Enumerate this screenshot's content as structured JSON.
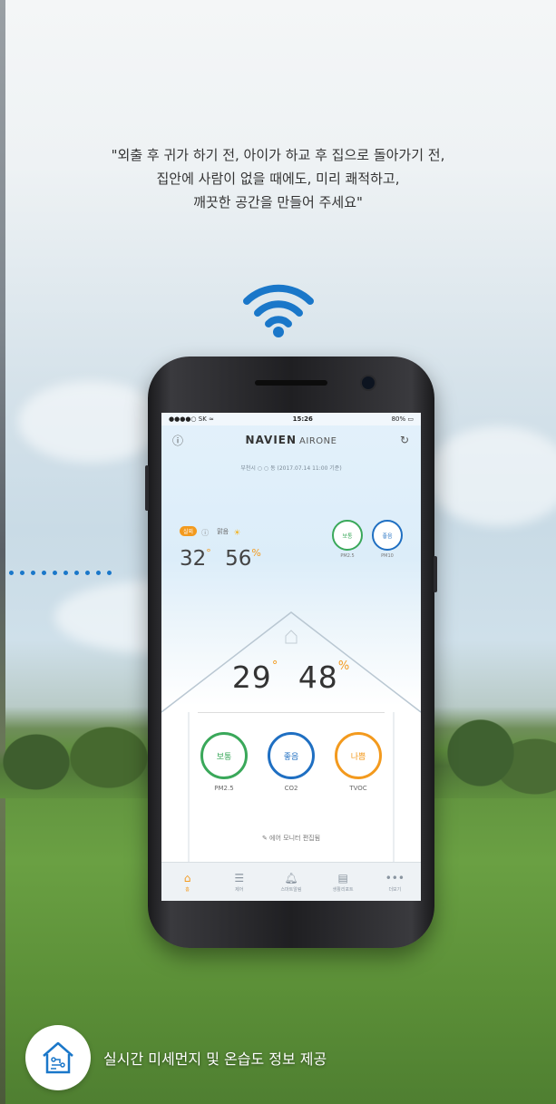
{
  "quote": {
    "line1": "\"외출 후 귀가 하기 전, 아이가 하교 후 집으로 돌아가기 전,",
    "line2": "집안에 사람이 없을 때에도, 미리 쾌적하고,",
    "line3": "깨끗한 공간을 만들어 주세요\""
  },
  "status_bar": {
    "carrier": "●●●●○ SK ≈",
    "time": "15:26",
    "battery": "80%"
  },
  "app": {
    "brand": "NAVIEN",
    "brand_sub": "AIRONE",
    "location": "부천시 ○ ○ 동 (2017.07.14 11:00 기준)"
  },
  "outdoor": {
    "tag": "실외",
    "weather": "맑음",
    "temp": "32",
    "temp_unit": "°",
    "humidity": "56",
    "humidity_unit": "%",
    "pm25": {
      "status": "보통",
      "label": "PM2.5"
    },
    "pm10": {
      "status": "좋음",
      "label": "PM10"
    }
  },
  "indoor": {
    "temp": "29",
    "temp_unit": "°",
    "humidity": "48",
    "humidity_unit": "%",
    "gauges": [
      {
        "status": "보통",
        "label": "PM2.5",
        "color": "#3aa85a"
      },
      {
        "status": "좋음",
        "label": "CO2",
        "color": "#1f6fc2"
      },
      {
        "status": "나쁨",
        "label": "TVOC",
        "color": "#f39a1e"
      }
    ],
    "airmap_link": "에어 모니터 편집됨"
  },
  "tabs": [
    {
      "label": "홈",
      "icon": "home-icon"
    },
    {
      "label": "제어",
      "icon": "sliders-icon"
    },
    {
      "label": "스마트알림",
      "icon": "bell-icon"
    },
    {
      "label": "생활리포트",
      "icon": "report-icon"
    },
    {
      "label": "더보기",
      "icon": "more-icon"
    }
  ],
  "feature": {
    "text": "실시간 미세먼지 및 온습도 정보 제공",
    "icon": "smart-house-icon"
  },
  "colors": {
    "accent": "#f39a1e",
    "blue": "#1f6fc2",
    "green": "#3aa85a",
    "wifi": "#1a77c9"
  }
}
